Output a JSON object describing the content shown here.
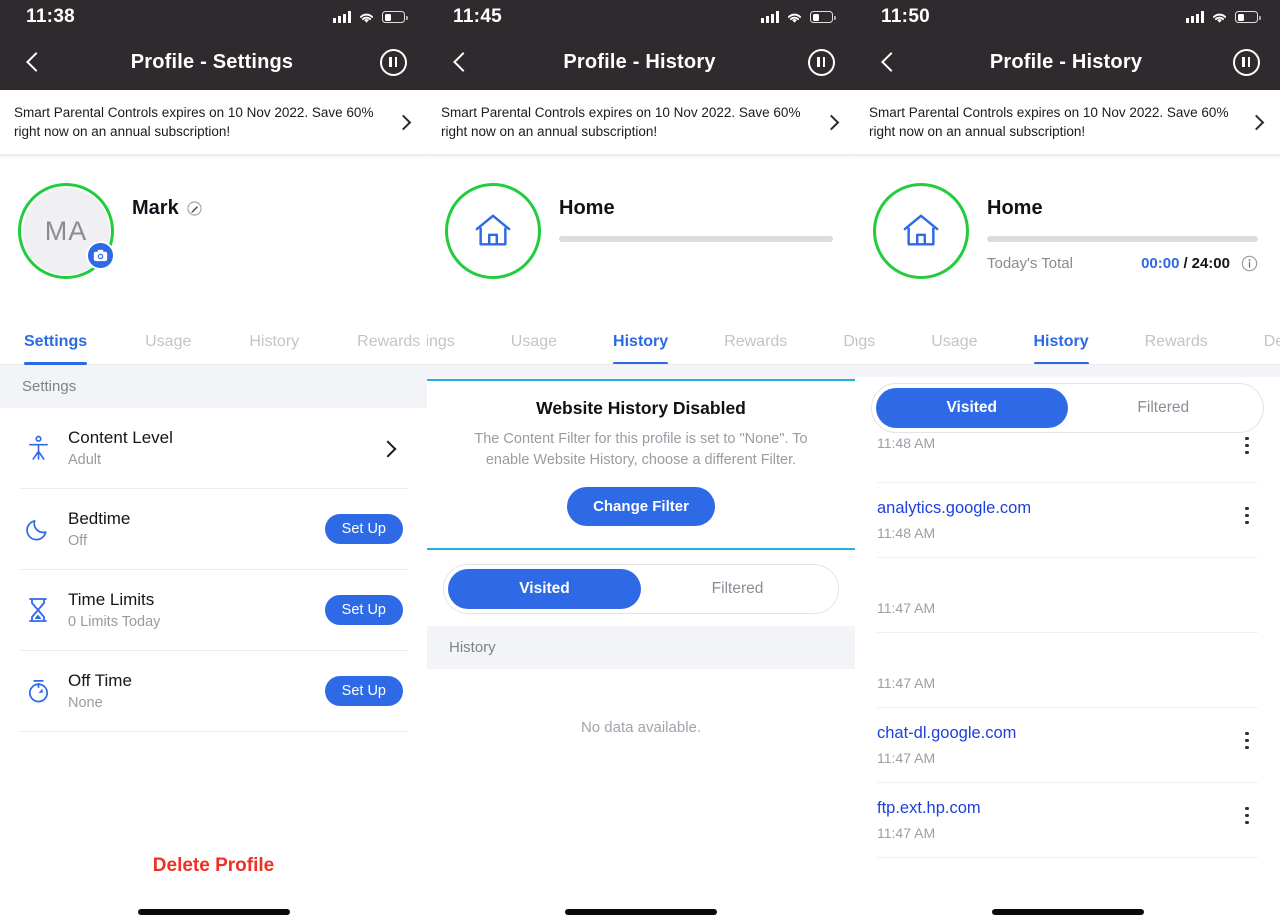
{
  "colors": {
    "accent_blue": "#2e6ae6",
    "link_blue": "#1d3fe0",
    "ring_green": "#22cc3d",
    "navbar_dark": "#2e2a2e",
    "danger_red": "#ee3124",
    "divider_cyan": "#24b0e0",
    "muted_gray": "#9a9aa2"
  },
  "promo": {
    "text": "Smart Parental Controls expires on 10 Nov 2022. Save 60% right now on an annual subscription!",
    "chevron_icon": "chevron-right-icon"
  },
  "panel1": {
    "status": {
      "time": "11:38",
      "signal_icon": "cellular-signal-icon",
      "wifi_icon": "wifi-icon",
      "battery_icon": "battery-low-icon"
    },
    "nav": {
      "title": "Profile - Settings",
      "back_icon": "chevron-left-icon",
      "pause_icon": "pause-circle-icon"
    },
    "profile": {
      "initials": "MA",
      "name": "Mark",
      "edit_icon": "edit-pencil-icon",
      "camera_icon": "camera-icon"
    },
    "tabs": [
      {
        "label": "Settings",
        "active": true
      },
      {
        "label": "Usage",
        "active": false
      },
      {
        "label": "History",
        "active": false
      },
      {
        "label": "Rewards",
        "active": false
      }
    ],
    "section_header": "Settings",
    "rows": [
      {
        "icon": "accessibility-person-icon",
        "title": "Content Level",
        "sub": "Adult",
        "action": "chevron",
        "action_label": ""
      },
      {
        "icon": "moon-icon",
        "title": "Bedtime",
        "sub": "Off",
        "action": "button",
        "action_label": "Set Up"
      },
      {
        "icon": "hourglass-icon",
        "title": "Time Limits",
        "sub": "0 Limits Today",
        "action": "button",
        "action_label": "Set Up"
      },
      {
        "icon": "stopwatch-icon",
        "title": "Off Time",
        "sub": "None",
        "action": "button",
        "action_label": "Set Up"
      }
    ],
    "delete_label": "Delete Profile"
  },
  "panel2": {
    "status": {
      "time": "11:45"
    },
    "nav": {
      "title": "Profile - History"
    },
    "profile": {
      "name": "Home",
      "home_icon": "home-icon"
    },
    "tabs": [
      {
        "label": "tings",
        "active": false
      },
      {
        "label": "Usage",
        "active": false
      },
      {
        "label": "History",
        "active": true
      },
      {
        "label": "Rewards",
        "active": false
      },
      {
        "label": "De",
        "active": false
      }
    ],
    "notice": {
      "title": "Website History Disabled",
      "body": "The Content Filter for this profile is set to \"None\". To enable Website History, choose a different Filter.",
      "button": "Change Filter"
    },
    "segment": {
      "options": [
        "Visited",
        "Filtered"
      ],
      "selected": "Visited"
    },
    "section_header": "History",
    "empty_text": "No data available."
  },
  "panel3": {
    "status": {
      "time": "11:50"
    },
    "nav": {
      "title": "Profile - History"
    },
    "profile": {
      "name": "Home",
      "home_icon": "home-icon"
    },
    "usage": {
      "label": "Today's Total",
      "used": "00:00",
      "separator": "/",
      "total": "24:00",
      "info_icon": "info-circle-icon",
      "progress_percent": 0
    },
    "tabs": [
      {
        "label": "Detings",
        "active": false
      },
      {
        "label": "Usage",
        "active": false
      },
      {
        "label": "History",
        "active": true
      },
      {
        "label": "Rewards",
        "active": false
      },
      {
        "label": "De",
        "active": false
      }
    ],
    "segment": {
      "options": [
        "Visited",
        "Filtered"
      ],
      "selected": "Visited"
    },
    "history_items": [
      {
        "url": "",
        "time": "11:48 AM",
        "menu_icon": "kebab-menu-icon"
      },
      {
        "url": "analytics.google.com",
        "time": "11:48 AM",
        "menu_icon": "kebab-menu-icon"
      },
      {
        "url": "",
        "time": "11:47 AM",
        "menu_icon": "kebab-menu-icon"
      },
      {
        "url": "",
        "time": "11:47 AM",
        "menu_icon": "kebab-menu-icon"
      },
      {
        "url": "chat-dl.google.com",
        "time": "11:47 AM",
        "menu_icon": "kebab-menu-icon"
      },
      {
        "url": "ftp.ext.hp.com",
        "time": "11:47 AM",
        "menu_icon": "kebab-menu-icon"
      }
    ]
  }
}
